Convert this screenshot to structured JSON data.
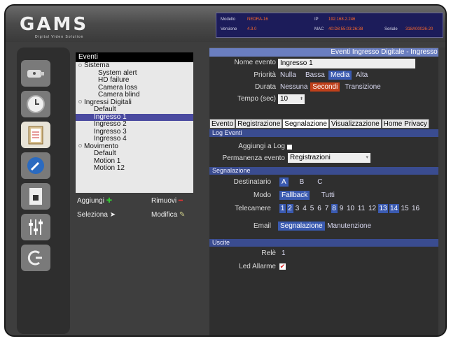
{
  "header": {
    "logo_text": "GAMS",
    "logo_sub": "Digital Video Solution",
    "info": {
      "modello_label": "Modello",
      "modello": "NEDRA-16",
      "versione_label": "Versione",
      "versione": "4.3.0",
      "ip_label": "IP",
      "ip": "192.168.2.246",
      "mac_label": "MAC",
      "mac": "40:D8:55:03:26:38",
      "seriale_label": "Seriale",
      "seriale": "318A00026-20"
    }
  },
  "nav": [
    "camera-icon",
    "clock-icon",
    "clipboard-icon",
    "wrench-icon",
    "document-lock-icon",
    "sliders-icon",
    "power-icon"
  ],
  "tree": {
    "header": "Eventi",
    "items": [
      {
        "label": "Sistema",
        "level": 0
      },
      {
        "label": "System alert",
        "level": 2
      },
      {
        "label": "HD failure",
        "level": 2
      },
      {
        "label": "Camera loss",
        "level": 2
      },
      {
        "label": "Camera blind",
        "level": 2
      },
      {
        "label": "Ingressi Digitali",
        "level": 0
      },
      {
        "label": "Default",
        "level": 1
      },
      {
        "label": "Ingresso 1",
        "level": 1,
        "selected": true
      },
      {
        "label": "Ingresso 2",
        "level": 1
      },
      {
        "label": "Ingresso 3",
        "level": 1
      },
      {
        "label": "Ingresso 4",
        "level": 1
      },
      {
        "label": "Movimento",
        "level": 0
      },
      {
        "label": "Default",
        "level": 1
      },
      {
        "label": "Motion 1",
        "level": 1
      },
      {
        "label": "Motion 12",
        "level": 1
      }
    ],
    "actions": {
      "add": "Aggiungi",
      "remove": "Rimuovi",
      "select": "Seleziona",
      "edit": "Modifica"
    }
  },
  "panel": {
    "title": "Eventi Ingresso Digitale - Ingresso 1",
    "nome_label": "Nome evento",
    "nome_value": "Ingresso 1",
    "priorita_label": "Priorità",
    "priorita_options": [
      "Nulla",
      "Bassa",
      "Media",
      "Alta"
    ],
    "priorita_selected": "Media",
    "durata_label": "Durata",
    "durata_options": [
      "Nessuna",
      "Secondi",
      "Transizione"
    ],
    "durata_selected": "Secondi",
    "tempo_label": "Tempo (sec)",
    "tempo_value": "10",
    "tabs": [
      "Evento",
      "Registrazione",
      "Segnalazione",
      "Visualizzazione",
      "Home Privacy"
    ],
    "tab_active": "Segnalazione",
    "log_section": "Log Eventi",
    "aggiungi_log_label": "Aggiungi a Log",
    "permanenza_label": "Permanenza evento",
    "permanenza_value": "Registrazioni",
    "segn_section": "Segnalazione",
    "dest_label": "Destinatario",
    "dest_options": [
      "A",
      "B",
      "C"
    ],
    "dest_selected": "A",
    "modo_label": "Modo",
    "modo_options": [
      "Fallback",
      "Tutti"
    ],
    "modo_selected": "Fallback",
    "tele_label": "Telecamere",
    "cameras": [
      "1",
      "2",
      "3",
      "4",
      "5",
      "6",
      "7",
      "8",
      "9",
      "10",
      "11",
      "12",
      "13",
      "14",
      "15",
      "16"
    ],
    "cameras_on": [
      "1",
      "2",
      "8",
      "13",
      "14"
    ],
    "email_label": "Email",
    "email_options": [
      "Segnalazione",
      "Manutenzione"
    ],
    "email_selected": "Segnalazione",
    "uscite_section": "Uscite",
    "rele_label": "Relè",
    "rele_value": "1",
    "led_label": "Led Allarme"
  }
}
